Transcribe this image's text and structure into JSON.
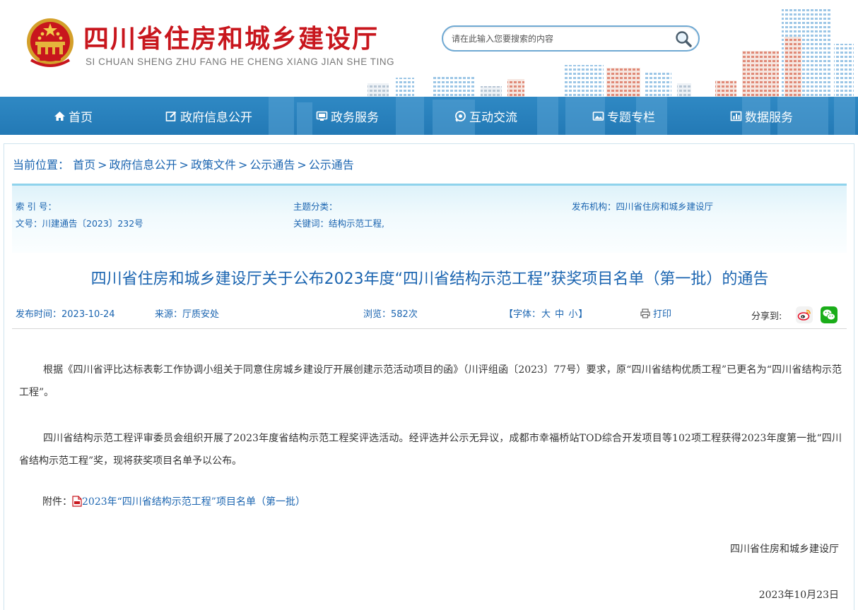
{
  "header": {
    "site_title": "四川省住房和城乡建设厅",
    "site_subtitle": "SI CHUAN SHENG ZHU FANG HE CHENG XIANG JIAN SHE TING",
    "search_placeholder": "请在此输入您要搜索的内容"
  },
  "nav": {
    "items": [
      {
        "label": "首页",
        "icon": "home-icon"
      },
      {
        "label": "政府信息公开",
        "icon": "edit-icon"
      },
      {
        "label": "政务服务",
        "icon": "monitor-icon"
      },
      {
        "label": "互动交流",
        "icon": "chat-icon"
      },
      {
        "label": "专题专栏",
        "icon": "image-icon"
      },
      {
        "label": "数据服务",
        "icon": "bar-chart-icon"
      }
    ]
  },
  "breadcrumb": {
    "prefix": "当前位置：",
    "items": [
      "首页",
      "政府信息公开",
      "政策文件",
      "公示通告",
      "公示通告"
    ],
    "separator": ">"
  },
  "meta": {
    "index_label": "索 引 号：",
    "index_value": "",
    "topic_label": "主题分类：",
    "topic_value": "",
    "publisher_label": "发布机构：",
    "publisher_value": "四川省住房和城乡建设厅",
    "docno_label": "文号：",
    "docno_value": "川建通告〔2023〕232号",
    "keywords_label": "关键词：",
    "keywords_value": "结构示范工程,"
  },
  "article": {
    "title": "四川省住房和城乡建设厅关于公布2023年度“四川省结构示范工程”获奖项目名单（第一批）的通告",
    "publish_time": "发布时间：2023-10-24",
    "source": "来源：厅质安处",
    "views": "浏览：582次",
    "font_size_prefix": "【字体：",
    "font_large": "大",
    "font_medium": "中",
    "font_small": "小",
    "font_size_suffix": "】",
    "print": "打印",
    "share_label": "分享到:",
    "paragraph1": "根据《四川省评比达标表彰工作协调小组关于同意住房城乡建设厅开展创建示范活动项目的函》（川评组函〔2023〕77号）要求，原“四川省结构优质工程”已更名为“四川省结构示范工程”。",
    "paragraph2": "四川省结构示范工程评审委员会组织开展了2023年度省结构示范工程奖评选活动。经评选并公示无异议，成都市幸福桥站TOD综合开发项目等102项工程获得2023年度第一批“四川省结构示范工程”奖，现将获奖项目名单予以公布。",
    "attachment_label": "附件：",
    "attachment_link": "2023年“四川省结构示范工程”项目名单（第一批）",
    "signer": "四川省住房和城乡建设厅",
    "sign_date": "2023年10月23日"
  },
  "colors": {
    "brand_red": "#c8161d",
    "nav_blue": "#2a82bf",
    "link_blue": "#1a64b0",
    "weibo": "#e6162d",
    "wechat": "#1aad19"
  }
}
